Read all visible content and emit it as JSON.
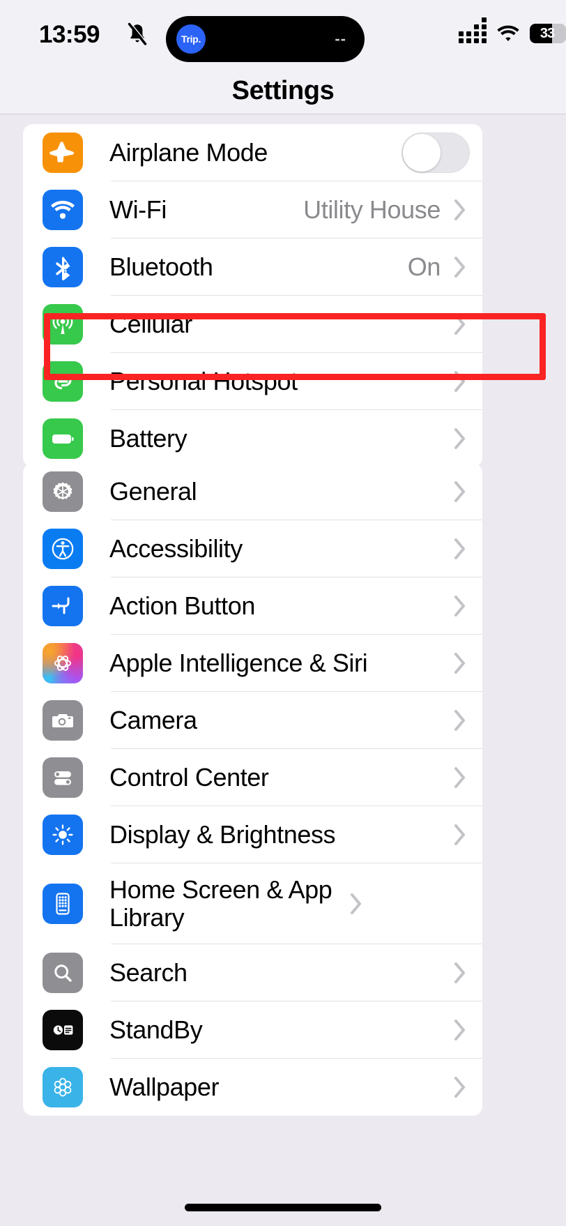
{
  "status_bar": {
    "time": "13:59",
    "mute_icon": "bell-slash-icon",
    "dynamic_island": {
      "app_label": "Trip.",
      "right_text": "--"
    },
    "cellular_icon": "cellular-signal-icon",
    "wifi_icon": "wifi-icon",
    "battery_percent": "33"
  },
  "nav": {
    "title": "Settings"
  },
  "groups": [
    {
      "id": "group1",
      "rows": [
        {
          "label": "Airplane Mode",
          "icon": "airplane-icon",
          "control": "toggle",
          "toggle_on": false
        },
        {
          "label": "Wi-Fi",
          "icon": "wifi-icon",
          "value": "Utility House",
          "control": "chevron"
        },
        {
          "label": "Bluetooth",
          "icon": "bluetooth-icon",
          "value": "On",
          "control": "chevron"
        },
        {
          "label": "Cellular",
          "icon": "cellular-antenna-icon",
          "value": "",
          "control": "chevron",
          "highlighted": true
        },
        {
          "label": "Personal Hotspot",
          "icon": "hotspot-link-icon",
          "value": "",
          "control": "chevron"
        },
        {
          "label": "Battery",
          "icon": "battery-icon",
          "value": "",
          "control": "chevron"
        }
      ]
    },
    {
      "id": "group2",
      "rows": [
        {
          "label": "General",
          "icon": "gear-icon",
          "value": "",
          "control": "chevron"
        },
        {
          "label": "Accessibility",
          "icon": "accessibility-icon",
          "value": "",
          "control": "chevron"
        },
        {
          "label": "Action Button",
          "icon": "action-button-icon",
          "value": "",
          "control": "chevron"
        },
        {
          "label": "Apple Intelligence & Siri",
          "icon": "apple-intelligence-icon",
          "value": "",
          "control": "chevron"
        },
        {
          "label": "Camera",
          "icon": "camera-icon",
          "value": "",
          "control": "chevron"
        },
        {
          "label": "Control Center",
          "icon": "control-center-icon",
          "value": "",
          "control": "chevron"
        },
        {
          "label": "Display & Brightness",
          "icon": "brightness-icon",
          "value": "",
          "control": "chevron"
        },
        {
          "label": "Home Screen & App Library",
          "icon": "home-screen-icon",
          "value": "",
          "control": "chevron",
          "two_line": true
        },
        {
          "label": "Search",
          "icon": "search-icon",
          "value": "",
          "control": "chevron"
        },
        {
          "label": "StandBy",
          "icon": "standby-icon",
          "value": "",
          "control": "chevron"
        },
        {
          "label": "Wallpaper",
          "icon": "wallpaper-icon",
          "value": "",
          "control": "chevron"
        }
      ]
    }
  ],
  "annotation": {
    "highlight_target": "Cellular",
    "highlight_color": "#fa2323"
  },
  "colors": {
    "page_bg": "#eceaf0",
    "card_bg": "#ffffff",
    "separator": "#e2e1e6",
    "secondary_text": "#8a8a8e",
    "chevron": "#c3c3c7"
  },
  "home_indicator": "home-indicator-bar"
}
